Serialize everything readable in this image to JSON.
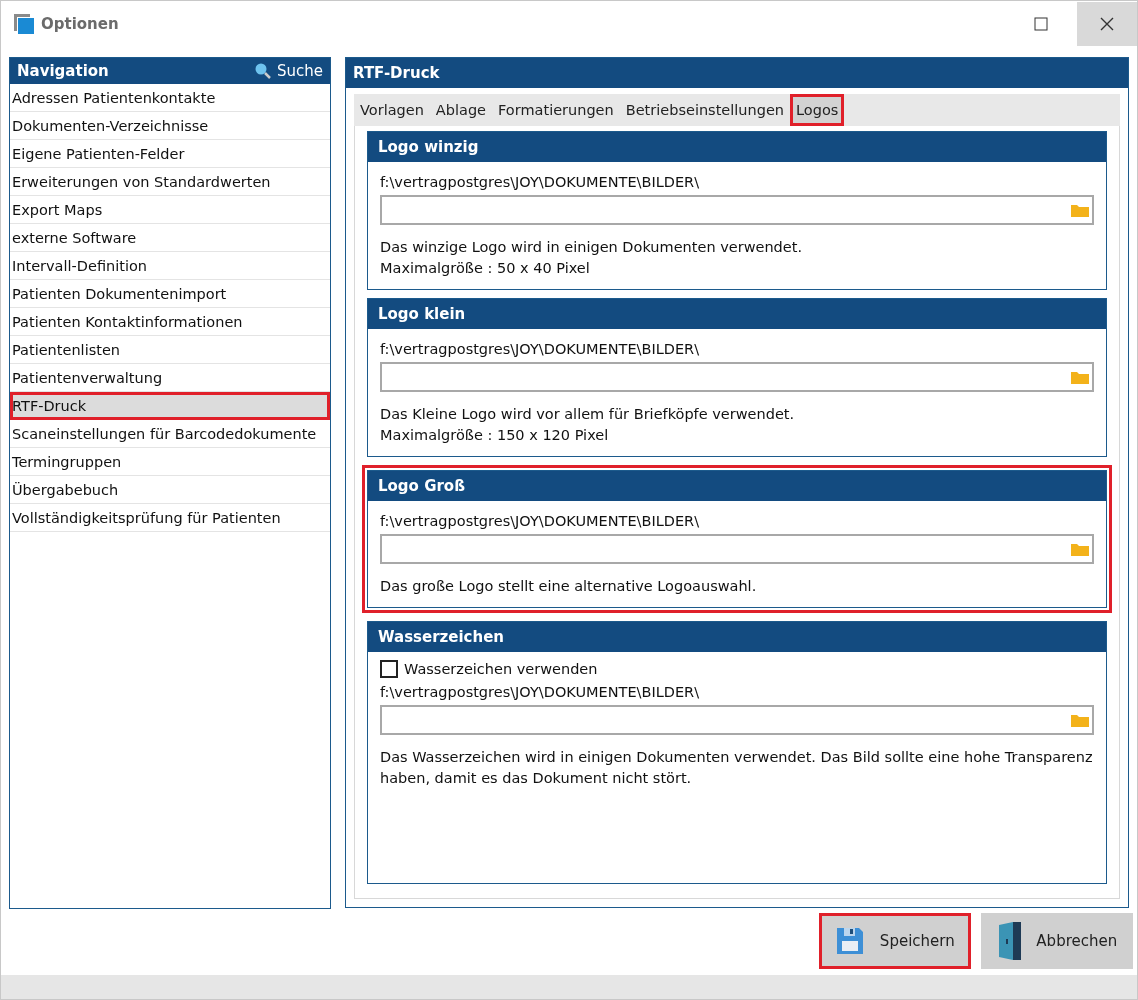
{
  "window": {
    "title": "Optionen"
  },
  "navigation": {
    "title": "Navigation",
    "search_label": "Suche",
    "items": [
      {
        "label": "Adressen Patientenkontakte",
        "selected": false,
        "highlighted": false
      },
      {
        "label": "Dokumenten-Verzeichnisse",
        "selected": false,
        "highlighted": false
      },
      {
        "label": "Eigene Patienten-Felder",
        "selected": false,
        "highlighted": false
      },
      {
        "label": "Erweiterungen von Standardwerten",
        "selected": false,
        "highlighted": false
      },
      {
        "label": "Export Maps",
        "selected": false,
        "highlighted": false
      },
      {
        "label": "externe Software",
        "selected": false,
        "highlighted": false
      },
      {
        "label": "Intervall-Definition",
        "selected": false,
        "highlighted": false
      },
      {
        "label": "Patienten Dokumentenimport",
        "selected": false,
        "highlighted": false
      },
      {
        "label": "Patienten Kontaktinformationen",
        "selected": false,
        "highlighted": false
      },
      {
        "label": "Patientenlisten",
        "selected": false,
        "highlighted": false
      },
      {
        "label": "Patientenverwaltung",
        "selected": false,
        "highlighted": false
      },
      {
        "label": "RTF-Druck",
        "selected": true,
        "highlighted": true
      },
      {
        "label": "Scaneinstellungen für Barcodedokumente",
        "selected": false,
        "highlighted": false
      },
      {
        "label": "Termingruppen",
        "selected": false,
        "highlighted": false
      },
      {
        "label": "Übergabebuch",
        "selected": false,
        "highlighted": false
      },
      {
        "label": "Vollständigkeitsprüfung für Patienten",
        "selected": false,
        "highlighted": false
      }
    ]
  },
  "content": {
    "title": "RTF-Druck",
    "tabs": [
      {
        "label": "Vorlagen",
        "selected": false,
        "highlighted": false
      },
      {
        "label": "Ablage",
        "selected": false,
        "highlighted": false
      },
      {
        "label": "Formatierungen",
        "selected": false,
        "highlighted": false
      },
      {
        "label": "Betriebseinstellungen",
        "selected": false,
        "highlighted": false
      },
      {
        "label": "Logos",
        "selected": true,
        "highlighted": true
      }
    ],
    "groups": [
      {
        "title": "Logo winzig",
        "highlighted": false,
        "path": "f:\\vertragpostgres\\JOY\\DOKUMENTE\\BILDER\\",
        "description": [
          "Das winzige Logo wird in einigen Dokumenten verwendet.",
          "Maximalgröße : 50 x 40 Pixel"
        ]
      },
      {
        "title": "Logo klein",
        "highlighted": false,
        "path": "f:\\vertragpostgres\\JOY\\DOKUMENTE\\BILDER\\",
        "description": [
          "Das Kleine Logo wird vor allem für Briefköpfe verwendet.",
          "Maximalgröße : 150 x 120 Pixel"
        ]
      },
      {
        "title": "Logo Groß",
        "highlighted": true,
        "path": "f:\\vertragpostgres\\JOY\\DOKUMENTE\\BILDER\\",
        "description": [
          "Das große Logo stellt eine alternative Logoauswahl."
        ]
      },
      {
        "title": "Wasserzeichen",
        "highlighted": false,
        "checkbox": {
          "label": "Wasserzeichen verwenden",
          "checked": false
        },
        "path": "f:\\vertragpostgres\\JOY\\DOKUMENTE\\BILDER\\",
        "description": [
          "Das Wasserzeichen wird in einigen Dokumenten verwendet. Das Bild sollte eine hohe Transparenz haben, damit es das Dokument nicht stört."
        ]
      }
    ]
  },
  "buttons": [
    {
      "label": "Speichern",
      "kind": "save",
      "highlighted": true
    },
    {
      "label": "Abbrechen",
      "kind": "cancel",
      "highlighted": false
    }
  ]
}
